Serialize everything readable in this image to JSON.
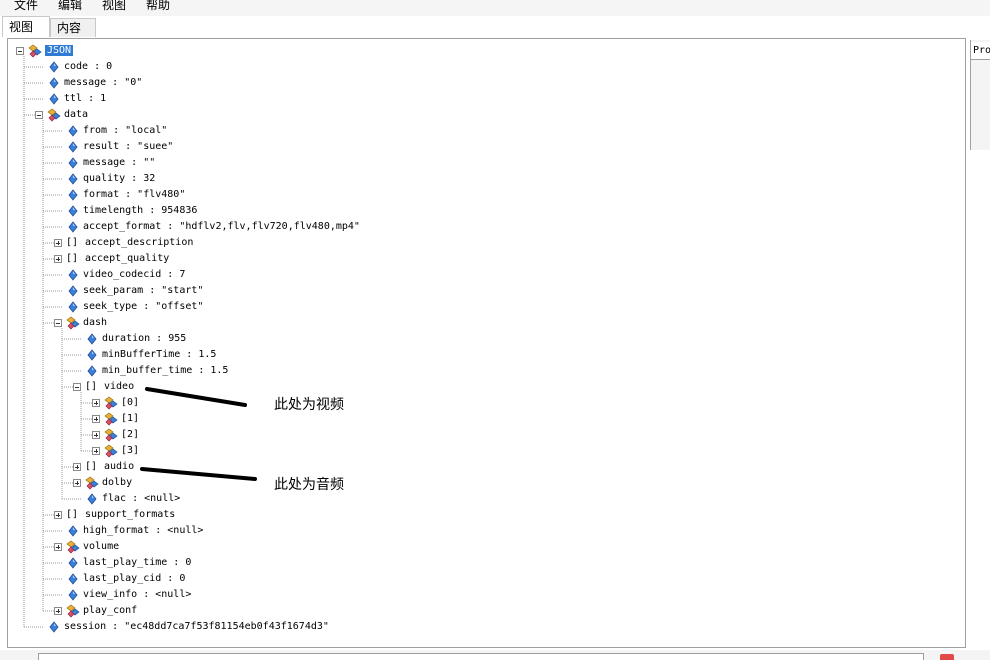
{
  "menubar": {
    "items": [
      "文件",
      "编辑",
      "视图",
      "帮助"
    ]
  },
  "tabs": [
    {
      "label": "视图",
      "active": true
    },
    {
      "label": "内容",
      "active": false
    }
  ],
  "right_panel": {
    "header": "Pro"
  },
  "bottom_bar": {
    "label": ""
  },
  "tree": [
    {
      "label": "JSON",
      "depth": 0,
      "kind": "object",
      "toggle": "open",
      "selected": true
    },
    {
      "label": "code : 0",
      "depth": 1,
      "kind": "value"
    },
    {
      "label": "message : \"0\"",
      "depth": 1,
      "kind": "value"
    },
    {
      "label": "ttl : 1",
      "depth": 1,
      "kind": "value"
    },
    {
      "label": "data",
      "depth": 1,
      "kind": "object",
      "toggle": "open"
    },
    {
      "label": "from : \"local\"",
      "depth": 2,
      "kind": "value"
    },
    {
      "label": "result : \"suee\"",
      "depth": 2,
      "kind": "value"
    },
    {
      "label": "message : \"\"",
      "depth": 2,
      "kind": "value"
    },
    {
      "label": "quality : 32",
      "depth": 2,
      "kind": "value"
    },
    {
      "label": "format : \"flv480\"",
      "depth": 2,
      "kind": "value"
    },
    {
      "label": "timelength : 954836",
      "depth": 2,
      "kind": "value"
    },
    {
      "label": "accept_format : \"hdflv2,flv,flv720,flv480,mp4\"",
      "depth": 2,
      "kind": "value"
    },
    {
      "label": "accept_description",
      "depth": 2,
      "kind": "array",
      "toggle": "closed"
    },
    {
      "label": "accept_quality",
      "depth": 2,
      "kind": "array",
      "toggle": "closed"
    },
    {
      "label": "video_codecid : 7",
      "depth": 2,
      "kind": "value"
    },
    {
      "label": "seek_param : \"start\"",
      "depth": 2,
      "kind": "value"
    },
    {
      "label": "seek_type : \"offset\"",
      "depth": 2,
      "kind": "value"
    },
    {
      "label": "dash",
      "depth": 2,
      "kind": "object",
      "toggle": "open"
    },
    {
      "label": "duration : 955",
      "depth": 3,
      "kind": "value"
    },
    {
      "label": "minBufferTime : 1.5",
      "depth": 3,
      "kind": "value"
    },
    {
      "label": "min_buffer_time : 1.5",
      "depth": 3,
      "kind": "value"
    },
    {
      "label": "video",
      "depth": 3,
      "kind": "array",
      "toggle": "open"
    },
    {
      "label": "[0]",
      "depth": 4,
      "kind": "object",
      "toggle": "closed"
    },
    {
      "label": "[1]",
      "depth": 4,
      "kind": "object",
      "toggle": "closed"
    },
    {
      "label": "[2]",
      "depth": 4,
      "kind": "object",
      "toggle": "closed"
    },
    {
      "label": "[3]",
      "depth": 4,
      "kind": "object",
      "toggle": "closed"
    },
    {
      "label": "audio",
      "depth": 3,
      "kind": "array",
      "toggle": "closed"
    },
    {
      "label": "dolby",
      "depth": 3,
      "kind": "object",
      "toggle": "closed"
    },
    {
      "label": "flac : <null>",
      "depth": 3,
      "kind": "value"
    },
    {
      "label": "support_formats",
      "depth": 2,
      "kind": "array",
      "toggle": "closed"
    },
    {
      "label": "high_format : <null>",
      "depth": 2,
      "kind": "value"
    },
    {
      "label": "volume",
      "depth": 2,
      "kind": "object",
      "toggle": "closed"
    },
    {
      "label": "last_play_time : 0",
      "depth": 2,
      "kind": "value"
    },
    {
      "label": "last_play_cid : 0",
      "depth": 2,
      "kind": "value"
    },
    {
      "label": "view_info : <null>",
      "depth": 2,
      "kind": "value"
    },
    {
      "label": "play_conf",
      "depth": 2,
      "kind": "object",
      "toggle": "closed"
    },
    {
      "label": "session : \"ec48dd7ca7f53f81154eb0f43f1674d3\"",
      "depth": 1,
      "kind": "value"
    }
  ],
  "annotations": {
    "video_note": "此处为视频",
    "audio_note": "此处为音频"
  }
}
